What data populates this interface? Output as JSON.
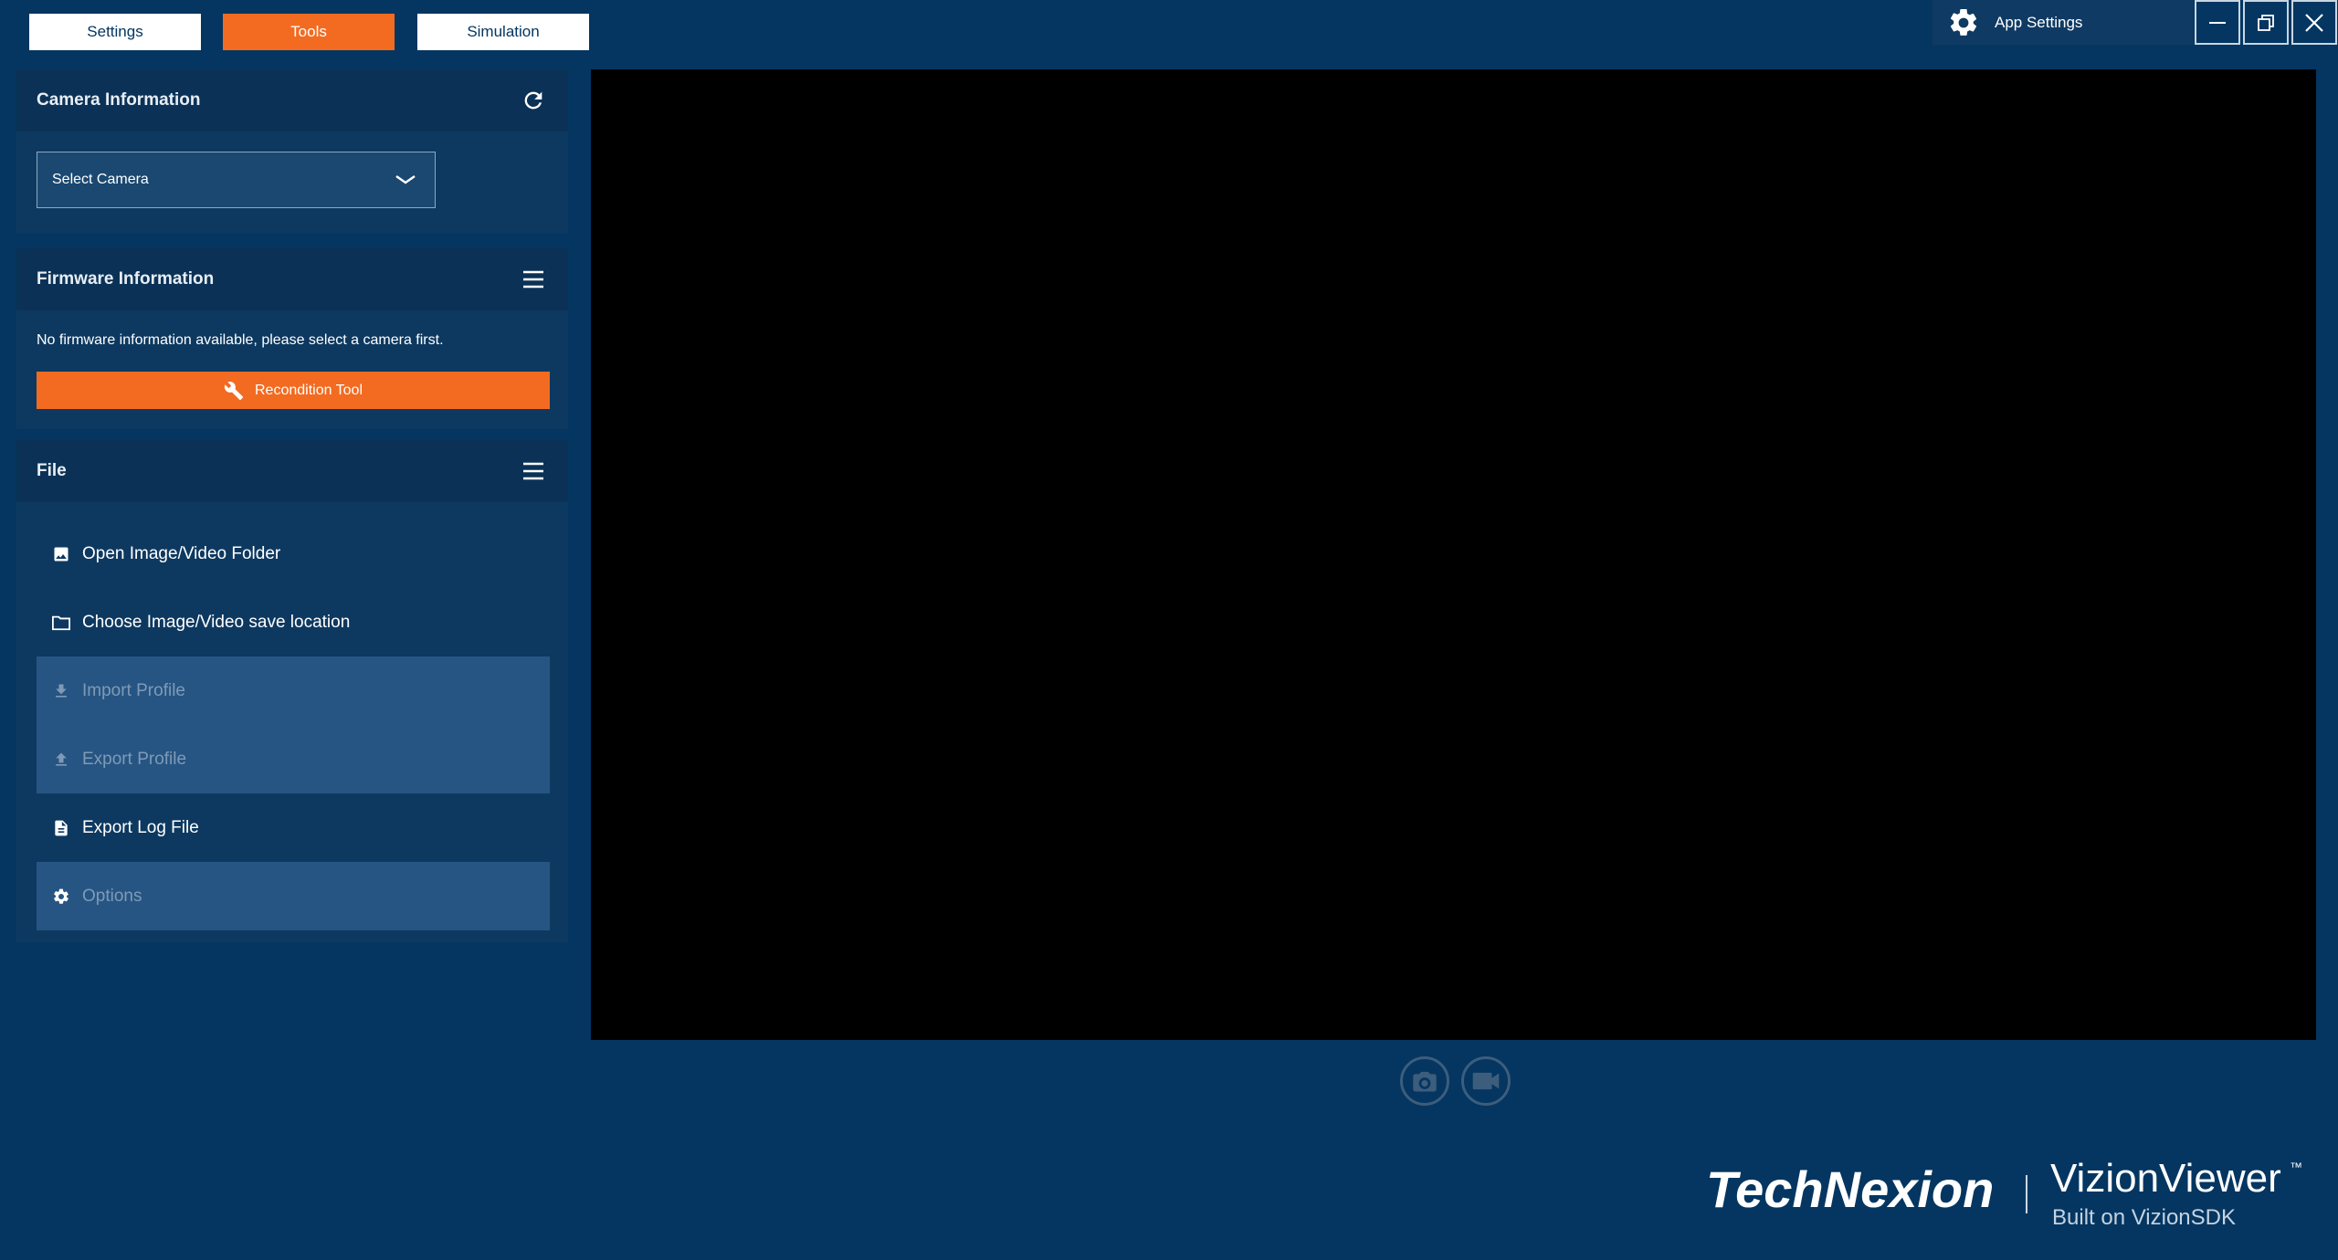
{
  "tabs": [
    {
      "label": "Settings",
      "active": false
    },
    {
      "label": "Tools",
      "active": true
    },
    {
      "label": "Simulation",
      "active": false
    }
  ],
  "app_settings": {
    "label": "App Settings",
    "icon": "gear-icon"
  },
  "window_controls": {
    "minimize": "minimize-icon",
    "restore": "restore-icon",
    "close": "close-icon"
  },
  "camera_panel": {
    "title": "Camera Information",
    "refresh_icon": "refresh-icon",
    "select": {
      "value": "Select Camera",
      "icon": "chevron-down-icon"
    }
  },
  "firmware_panel": {
    "title": "Firmware Information",
    "menu_icon": "hamburger-menu-icon",
    "message": "No firmware information available, please select a camera first.",
    "recondition_button": {
      "label": "Recondition Tool",
      "icon": "wrench-icon"
    }
  },
  "file_panel": {
    "title": "File",
    "menu_icon": "hamburger-menu-icon",
    "items": [
      {
        "label": "Open Image/Video Folder",
        "icon": "image-icon",
        "enabled": true
      },
      {
        "label": "Choose Image/Video save location",
        "icon": "folder-icon",
        "enabled": true
      },
      {
        "label": "Import Profile",
        "icon": "download-icon",
        "enabled": false
      },
      {
        "label": "Export Profile",
        "icon": "upload-icon",
        "enabled": false
      },
      {
        "label": "Export Log File",
        "icon": "document-icon",
        "enabled": true
      },
      {
        "label": "Options",
        "icon": "gear-icon",
        "enabled": false
      }
    ]
  },
  "capture_controls": {
    "snapshot_icon": "camera-icon",
    "record_icon": "video-camera-icon"
  },
  "brand": {
    "company": "TechNexion",
    "product": "VizionViewer",
    "trademark": "™",
    "subtitle": "Built on VizionSDK"
  },
  "colors": {
    "background": "#043661",
    "accent": "#f26b21",
    "panel": "#0d3960",
    "disabled_item": "#265583",
    "video": "#000000"
  }
}
